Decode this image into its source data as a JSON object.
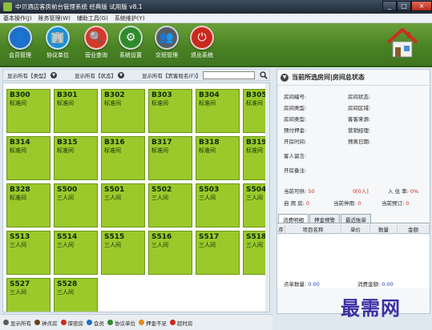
{
  "window": {
    "title": "中贝酒店客房前台管理系统 经典版 试用版 v8.1",
    "min": "_",
    "max": "□",
    "close": "×"
  },
  "menu": [
    "基本操作(J)",
    "账务管理(W)",
    "辅助工具(G)",
    "系统维护(Y)"
  ],
  "toolbar": [
    {
      "label": "会员管理",
      "icon": "member-icon",
      "glyph": "👤",
      "color": "#1e6fc9"
    },
    {
      "label": "协议单位",
      "icon": "agreement-icon",
      "glyph": "🏢",
      "color": "#1f8fd6"
    },
    {
      "label": "营业查询",
      "icon": "search-icon",
      "glyph": "🔍",
      "color": "#d23a2b"
    },
    {
      "label": "系统设置",
      "icon": "gear-icon",
      "glyph": "⚙",
      "color": "#2f8a2b"
    },
    {
      "label": "交班管理",
      "icon": "shift-icon",
      "glyph": "👥",
      "color": "#555d66"
    },
    {
      "label": "退出系统",
      "icon": "power-icon",
      "glyph": "⏻",
      "color": "#c82a1e"
    }
  ],
  "filters": {
    "type": "显示所有【类型】",
    "status": "显示所有【状态】",
    "search_label": "显示所有【宾客姓名(F)】",
    "search_placeholder": ""
  },
  "rooms": [
    {
      "no": "B300",
      "type": "标准间"
    },
    {
      "no": "B301",
      "type": "标准间"
    },
    {
      "no": "B302",
      "type": "标准间"
    },
    {
      "no": "B303",
      "type": "标准间"
    },
    {
      "no": "B304",
      "type": "标准间"
    },
    {
      "no": "B305",
      "type": "标准间"
    },
    {
      "no": "B314",
      "type": "标准间"
    },
    {
      "no": "B315",
      "type": "标准间"
    },
    {
      "no": "B316",
      "type": "标准间"
    },
    {
      "no": "B317",
      "type": "标准间"
    },
    {
      "no": "B318",
      "type": "标准间"
    },
    {
      "no": "B319",
      "type": "标准间"
    },
    {
      "no": "B328",
      "type": "标准间"
    },
    {
      "no": "S500",
      "type": "三人间"
    },
    {
      "no": "S501",
      "type": "三人间"
    },
    {
      "no": "S502",
      "type": "三人间"
    },
    {
      "no": "S503",
      "type": "三人间"
    },
    {
      "no": "S504",
      "type": "三人间"
    },
    {
      "no": "S513",
      "type": "三人间"
    },
    {
      "no": "S514",
      "type": "三人间"
    },
    {
      "no": "S515",
      "type": "三人间"
    },
    {
      "no": "S516",
      "type": "三人间"
    },
    {
      "no": "S517",
      "type": "三人间"
    },
    {
      "no": "S518",
      "type": "三人间"
    },
    {
      "no": "S527",
      "type": "三人间"
    },
    {
      "no": "S528",
      "type": "三人间"
    }
  ],
  "legend": [
    {
      "label": "显示所有",
      "color": "#5a5a5a"
    },
    {
      "label": "钟点房",
      "color": "#6b3f1a"
    },
    {
      "label": "保密房",
      "color": "#d0281b"
    },
    {
      "label": "会员",
      "color": "#1e6fc9"
    },
    {
      "label": "协议单位",
      "color": "#2f8a2b"
    },
    {
      "label": "押金不足",
      "color": "#e88a1a"
    },
    {
      "label": "超时房",
      "color": "#c82a1e"
    }
  ],
  "right_panel": {
    "title": "当前所选房间|房间总状态",
    "fields_left": [
      "房间编号:",
      "房间类型:",
      "房间类型:",
      "预付押金:",
      "开房时间:",
      "客人留言:",
      "开房备注:"
    ],
    "fields_right": [
      "房间状态:",
      "房间区域:",
      "客客来源:",
      "营销经理:",
      "预离日期:"
    ],
    "stats": {
      "current_label": "当前可供:",
      "current_value": "50",
      "current_unit": "0[0人]",
      "checkin_label": "入 住 率:",
      "checkin_value": "0%",
      "self_use_label": "自 用 房:",
      "self_use_value": "0",
      "stopped_label": "当前停用:",
      "stopped_value": "0",
      "reserved_label": "当前预订:",
      "reserved_value": "0"
    },
    "tabs": [
      "消费明细",
      "押金预警",
      "最近账单"
    ],
    "table_headers": [
      "序",
      "项目名称",
      "单价",
      "数量",
      "金额"
    ],
    "points_label": "点单数量:",
    "points_value": "0.00",
    "total_label": "消费金额:",
    "total_value": "0.00"
  },
  "watermark": "最需网"
}
